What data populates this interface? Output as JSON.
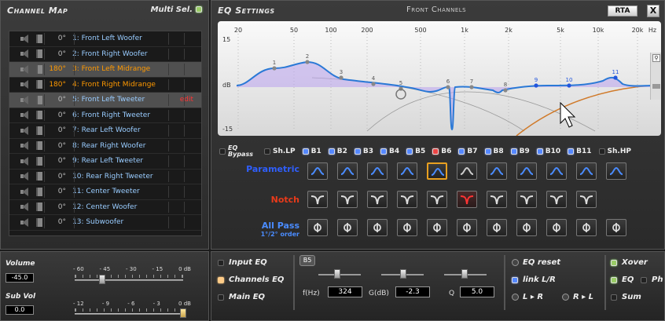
{
  "channel_map": {
    "title": "Channel Map",
    "multi_sel": "Multi Sel.",
    "channels": [
      {
        "phase": "0°",
        "name": "1: Front Left Woofer",
        "selected": false,
        "phase_inverted": false
      },
      {
        "phase": "0°",
        "name": "2: Front Right Woofer",
        "selected": false,
        "phase_inverted": false
      },
      {
        "phase": "180°",
        "name": "3: Front Left Midrange",
        "selected": true,
        "phase_inverted": true
      },
      {
        "phase": "180°",
        "name": "4: Front Right Midrange",
        "selected": false,
        "phase_inverted": true
      },
      {
        "phase": "0°",
        "name": "5: Front Left Tweeter",
        "selected": true,
        "phase_inverted": false,
        "edit": "edit"
      },
      {
        "phase": "0°",
        "name": "6: Front Right Tweeter",
        "selected": false,
        "phase_inverted": false
      },
      {
        "phase": "0°",
        "name": "7: Rear Left Woofer",
        "selected": false,
        "phase_inverted": false
      },
      {
        "phase": "0°",
        "name": "8: Rear Right Woofer",
        "selected": false,
        "phase_inverted": false
      },
      {
        "phase": "0°",
        "name": "9: Rear Left Tweeter",
        "selected": false,
        "phase_inverted": false
      },
      {
        "phase": "0°",
        "name": "10: Rear Right Tweeter",
        "selected": false,
        "phase_inverted": false
      },
      {
        "phase": "0°",
        "name": "11: Center Tweeter",
        "selected": false,
        "phase_inverted": false
      },
      {
        "phase": "0°",
        "name": "12: Center Woofer",
        "selected": false,
        "phase_inverted": false
      },
      {
        "phase": "0°",
        "name": "13: Subwoofer",
        "selected": false,
        "phase_inverted": false
      }
    ]
  },
  "volume": {
    "volume_label": "Volume",
    "volume_value": "-45.0",
    "volume_scale": [
      "- 60",
      "- 45",
      "- 30",
      "- 15",
      "0 dB"
    ],
    "volume_level": 0.25,
    "subvol_label": "Sub Vol",
    "subvol_value": "0.0",
    "subvol_scale": [
      "- 12",
      "- 9",
      "- 6",
      "- 3",
      "0 dB"
    ],
    "subvol_level": 1.0
  },
  "eq": {
    "title": "EQ Settings",
    "channels_label": "Front Channels",
    "rta_label": "RTA",
    "close_label": "X",
    "graph": {
      "freq_labels": [
        "20",
        "50",
        "100",
        "200",
        "500",
        "1k",
        "2k",
        "5k",
        "10k",
        "20k",
        "Hz"
      ],
      "db_top": "15",
      "db_mid": "dB",
      "db_bottom": "-15",
      "band_markers": [
        "1",
        "2",
        "3",
        "4",
        "5",
        "6",
        "7",
        "8",
        "9",
        "10",
        "11"
      ],
      "cursor_icon": "mouse-pointer-icon"
    },
    "bypass_label": "EQ Bypass",
    "shlp_label": "Sh.LP",
    "shhp_label": "Sh.HP",
    "bands": [
      "B1",
      "B2",
      "B3",
      "B4",
      "B5",
      "B6",
      "B7",
      "B8",
      "B9",
      "B10",
      "B11"
    ],
    "band_colors": {
      "active": "#5588ff",
      "notch": "#ee4444"
    },
    "type_labels": {
      "parametric": "Parametric",
      "notch": "Notch",
      "allpass": "All Pass",
      "allpass_sub": "1°/2° order"
    },
    "type_colors": {
      "parametric": "#2f5fff",
      "notch": "#e83a1a",
      "allpass": "#4a8cff"
    }
  },
  "bottom": {
    "input_eq": "Input EQ",
    "channels_eq": "Channels EQ",
    "main_eq": "Main EQ",
    "band_tab": "B5",
    "freq_label": "f(Hz)",
    "freq_value": "324",
    "gain_label": "G(dB)",
    "gain_value": "-2.3",
    "q_label": "Q",
    "q_value": "5.0",
    "eq_reset": "EQ reset",
    "link_lr": "link L/R",
    "l_to_r": "L ▸ R",
    "r_to_l": "R ▸ L",
    "xover": "Xover",
    "eq": "EQ",
    "ph": "Ph",
    "sum": "Sum"
  }
}
